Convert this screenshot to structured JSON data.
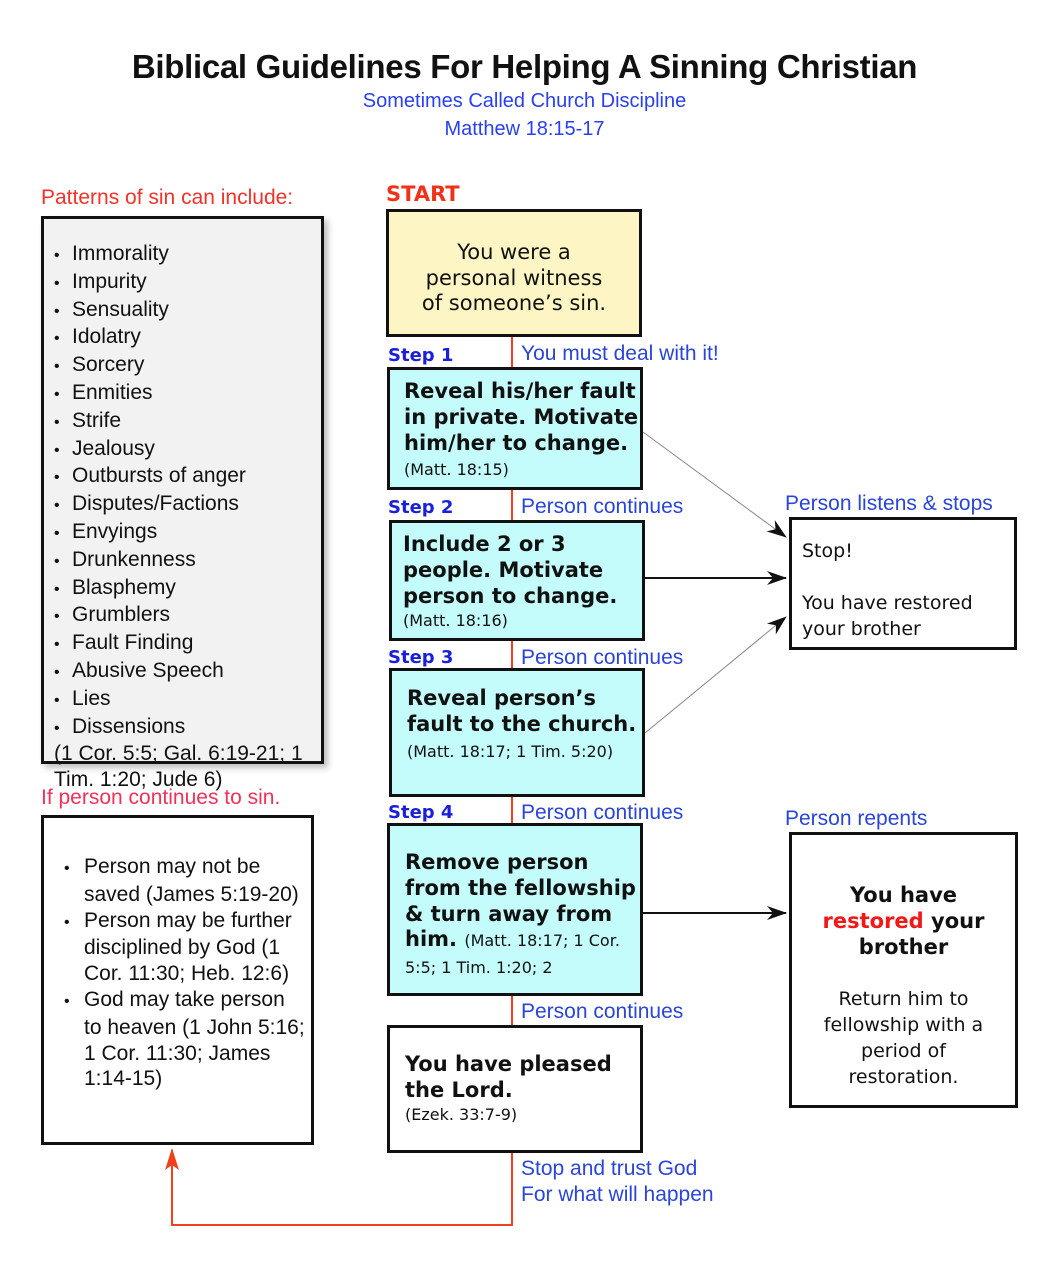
{
  "header": {
    "title": "Biblical Guidelines For Helping A Sinning Christian",
    "subtitle": "Sometimes Called Church Discipline",
    "scripture": "Matthew 18:15-17"
  },
  "sins_panel": {
    "heading": "Patterns of sin can include:",
    "items": [
      "Immorality",
      "Impurity",
      "Sensuality",
      "Idolatry",
      "Sorcery",
      "Enmities",
      "Strife",
      "Jealousy",
      "Outbursts of anger",
      "Disputes/Factions",
      "Envyings",
      "Drunkenness",
      "Blasphemy",
      "Grumblers",
      "Fault Finding",
      "Abusive Speech",
      "Lies",
      "Dissensions"
    ],
    "references": "(1 Cor. 5:5; Gal. 6:19-21; 1 Tim. 1:20; Jude 6)"
  },
  "consequences_panel": {
    "heading": "If person continues to sin.",
    "items": [
      "Person may not be saved (James 5:19-20)",
      "Person may be further disciplined by God (1 Cor. 11:30; Heb. 12:6)",
      "God may take person to heaven (1 John 5:16; 1 Cor. 11:30; James 1:14-15)"
    ]
  },
  "flow": {
    "start_label": "START",
    "start_box": "You were a personal witness of someone’s sin.",
    "steps": [
      {
        "label": "Step 1",
        "connector": "You must deal with it!",
        "text": "Reveal his/her fault in private. Motivate him/her to change.",
        "ref": "(Matt. 18:15)"
      },
      {
        "label": "Step  2",
        "connector": "Person continues",
        "text": "Include 2 or 3 people.  Motivate person to change.",
        "ref": "(Matt. 18:16)"
      },
      {
        "label": "Step 3",
        "connector": "Person continues",
        "text": "Reveal person’s fault to the church.",
        "ref": "(Matt. 18:17; 1 Tim. 5:20)"
      },
      {
        "label": "Step  4",
        "connector": "Person continues",
        "text": "Remove person from the fellowship & turn away from him.",
        "ref": "(Matt. 18:17; 1 Cor. 5:5; 1 Tim. 1:20;  2"
      }
    ],
    "final_connector": "Person continues",
    "pleased_box": {
      "head": "You have pleased the Lord.",
      "ref": "(Ezek. 33:7-9)"
    },
    "trust_label_line1": "Stop and trust God",
    "trust_label_line2": "For what will happen"
  },
  "outcomes": {
    "listens": {
      "label": "Person listens & stops",
      "line1": "Stop!",
      "line2": "You have restored your brother"
    },
    "repents": {
      "label": "Person repents",
      "head_pre": "You have",
      "head_highlight": "restored",
      "head_post": "your brother",
      "body": "Return him to fellowship with a period of restoration."
    }
  },
  "colors": {
    "accent_red": "#f0401e",
    "label_blue": "#2a45d8",
    "step_blue": "#1a20d8",
    "start_fill": "#fdf6c4",
    "step_fill": "#c4fcfc",
    "list_fill": "#f2f2f2"
  }
}
